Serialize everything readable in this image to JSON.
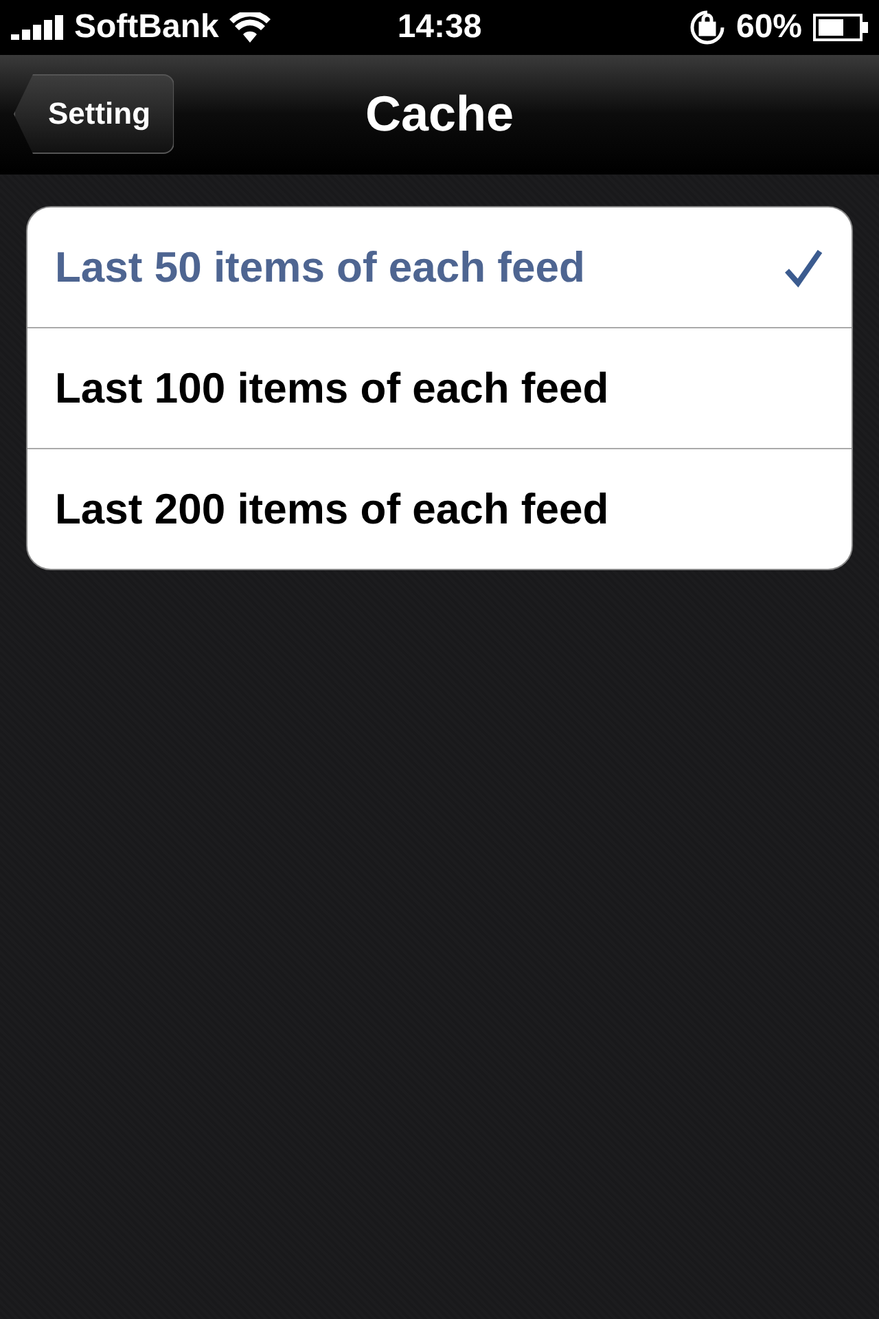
{
  "status_bar": {
    "carrier": "SoftBank",
    "time": "14:38",
    "battery": "60%"
  },
  "nav_bar": {
    "back": "Setting",
    "title": "Cache"
  },
  "options": [
    {
      "label": "Last 50 items of each feed",
      "selected": true
    },
    {
      "label": "Last 100 items of each feed",
      "selected": false
    },
    {
      "label": "Last 200 items of each feed",
      "selected": false
    }
  ]
}
